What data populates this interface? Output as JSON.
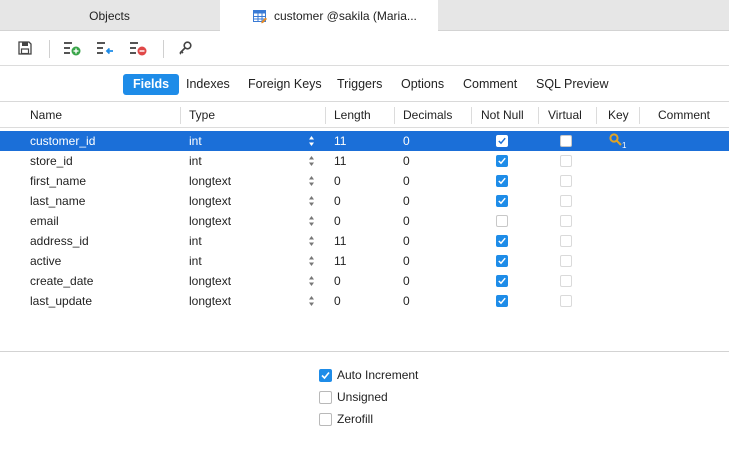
{
  "tabs": {
    "objects_label": "Objects",
    "customer_label": "customer @sakila (Maria..."
  },
  "subtabs": [
    "Fields",
    "Indexes",
    "Foreign Keys",
    "Triggers",
    "Options",
    "Comment",
    "SQL Preview"
  ],
  "columns": {
    "name": "Name",
    "type": "Type",
    "length": "Length",
    "decimals": "Decimals",
    "not_null": "Not Null",
    "virtual": "Virtual",
    "key": "Key",
    "comment": "Comment"
  },
  "rows": [
    {
      "name": "customer_id",
      "type": "int",
      "length": "11",
      "decimals": "0",
      "not_null": true,
      "virtual": false,
      "key": "1",
      "selected": true
    },
    {
      "name": "store_id",
      "type": "int",
      "length": "11",
      "decimals": "0",
      "not_null": true,
      "virtual": false,
      "key": ""
    },
    {
      "name": "first_name",
      "type": "longtext",
      "length": "0",
      "decimals": "0",
      "not_null": true,
      "virtual": false,
      "key": ""
    },
    {
      "name": "last_name",
      "type": "longtext",
      "length": "0",
      "decimals": "0",
      "not_null": true,
      "virtual": false,
      "key": ""
    },
    {
      "name": "email",
      "type": "longtext",
      "length": "0",
      "decimals": "0",
      "not_null": false,
      "virtual": false,
      "key": ""
    },
    {
      "name": "address_id",
      "type": "int",
      "length": "11",
      "decimals": "0",
      "not_null": true,
      "virtual": false,
      "key": ""
    },
    {
      "name": "active",
      "type": "int",
      "length": "11",
      "decimals": "0",
      "not_null": true,
      "virtual": false,
      "key": ""
    },
    {
      "name": "create_date",
      "type": "longtext",
      "length": "0",
      "decimals": "0",
      "not_null": true,
      "virtual": false,
      "key": ""
    },
    {
      "name": "last_update",
      "type": "longtext",
      "length": "0",
      "decimals": "0",
      "not_null": true,
      "virtual": false,
      "key": ""
    }
  ],
  "options": {
    "auto_increment": {
      "label": "Auto Increment",
      "checked": true
    },
    "unsigned": {
      "label": "Unsigned",
      "checked": false
    },
    "zerofill": {
      "label": "Zerofill",
      "checked": false
    }
  },
  "colors": {
    "accent": "#1e8ce8",
    "selection": "#1b6fd8",
    "key_icon": "#e0a323"
  },
  "icons": {
    "table_tab": "table-icon",
    "save": "save-icon",
    "add_field": "add-field-icon",
    "insert_field": "insert-field-icon",
    "delete_field": "delete-field-icon",
    "primary_key": "key-icon",
    "row_key": "key-icon"
  }
}
